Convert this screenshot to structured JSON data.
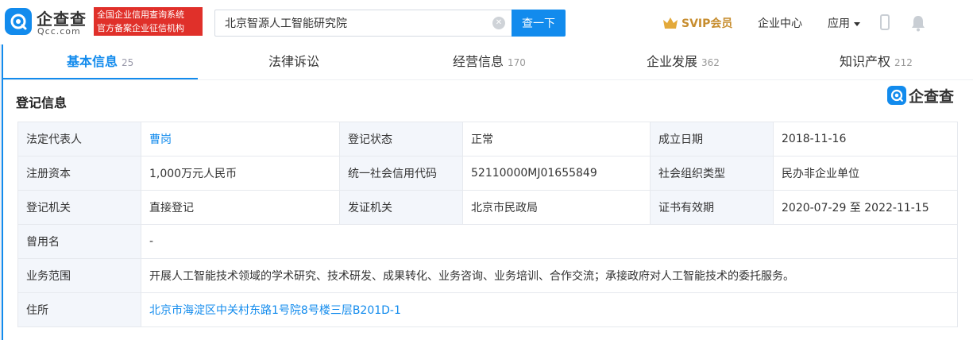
{
  "header": {
    "logo_text": "企查查",
    "logo_sub": "Qcc.com",
    "slogan_line1": "全国企业信用查询系统",
    "slogan_line2": "官方备案企业征信机构",
    "search_value": "北京智源人工智能研究院",
    "search_button": "查一下",
    "svip_label": "SVIP会员",
    "nav_enterprise_center": "企业中心",
    "nav_apps": "应用"
  },
  "tabs": [
    {
      "label": "基本信息",
      "count": "25"
    },
    {
      "label": "法律诉讼",
      "count": ""
    },
    {
      "label": "经营信息",
      "count": "170"
    },
    {
      "label": "企业发展",
      "count": "362"
    },
    {
      "label": "知识产权",
      "count": "212"
    }
  ],
  "section": {
    "title": "登记信息",
    "brand_badge": "企查查"
  },
  "info": {
    "legal_rep_label": "法定代表人",
    "legal_rep_value": "曹岗",
    "reg_status_label": "登记状态",
    "reg_status_value": "正常",
    "founded_label": "成立日期",
    "founded_value": "2018-11-16",
    "capital_label": "注册资本",
    "capital_value": "1,000万元人民币",
    "credit_code_label": "统一社会信用代码",
    "credit_code_value": "52110000MJ01655849",
    "org_type_label": "社会组织类型",
    "org_type_value": "民办非企业单位",
    "reg_authority_label": "登记机关",
    "reg_authority_value": "直接登记",
    "issuer_label": "发证机关",
    "issuer_value": "北京市民政局",
    "cert_valid_label": "证书有效期",
    "cert_valid_value": "2020-07-29 至 2022-11-15",
    "former_name_label": "曾用名",
    "former_name_value": "-",
    "scope_label": "业务范围",
    "scope_value": "开展人工智能技术领域的学术研究、技术研发、成果转化、业务咨询、业务培训、合作交流；承接政府对人工智能技术的委托服务。",
    "address_label": "住所",
    "address_value": "北京市海淀区中关村东路1号院8号楼三层B201D-1"
  },
  "colors": {
    "accent": "#128bed",
    "slogan_bg": "#e0302a",
    "svip": "#c78d2f",
    "label_bg": "#f3f6fb"
  }
}
